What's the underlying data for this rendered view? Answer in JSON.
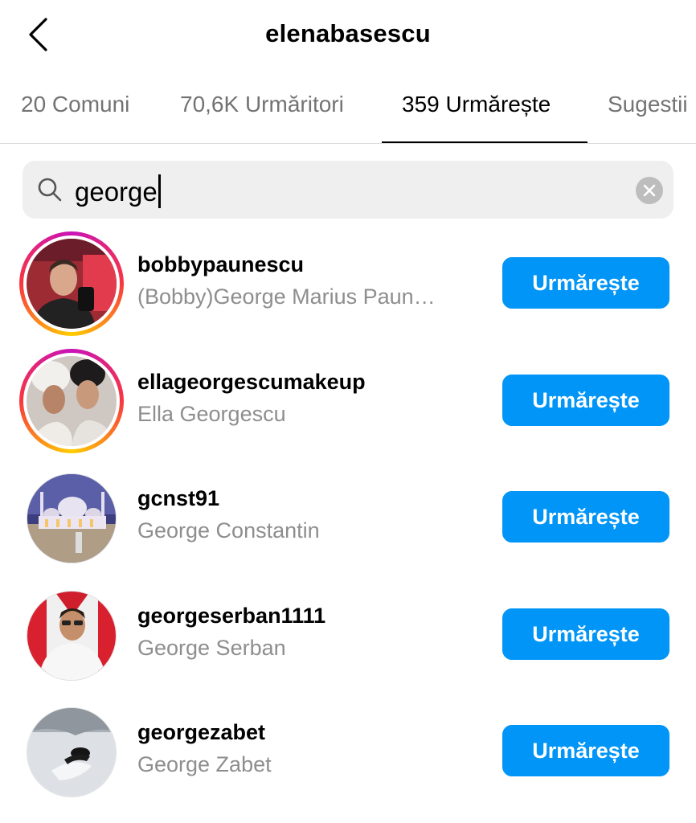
{
  "header": {
    "back_icon": "chevron-left-icon",
    "title": "elenabasescu"
  },
  "tabs": [
    {
      "label": "20 Comuni",
      "active": false
    },
    {
      "label": "70,6K Urmăritori",
      "active": false
    },
    {
      "label": "359 Urmărește",
      "active": true
    },
    {
      "label": "Sugestii",
      "active": false
    }
  ],
  "search": {
    "icon": "search-icon",
    "value": "george",
    "clear_icon": "clear-icon"
  },
  "results": [
    {
      "username": "bobbypaunescu",
      "full_name": "(Bobby)George Marius Paun…",
      "button": "Urmărește",
      "story_ring": true
    },
    {
      "username": "ellageorgescumakeup",
      "full_name": "Ella Georgescu",
      "button": "Urmărește",
      "story_ring": true
    },
    {
      "username": "gcnst91",
      "full_name": "George Constantin",
      "button": "Urmărește",
      "story_ring": false
    },
    {
      "username": "georgeserban1111",
      "full_name": "George Serban",
      "button": "Urmărește",
      "story_ring": false
    },
    {
      "username": "georgezabet",
      "full_name": "George Zabet",
      "button": "Urmărește",
      "story_ring": false
    }
  ],
  "colors": {
    "follow_button": "#0095f6",
    "secondary_text": "#8e8e8e",
    "search_bg": "#efefef"
  }
}
